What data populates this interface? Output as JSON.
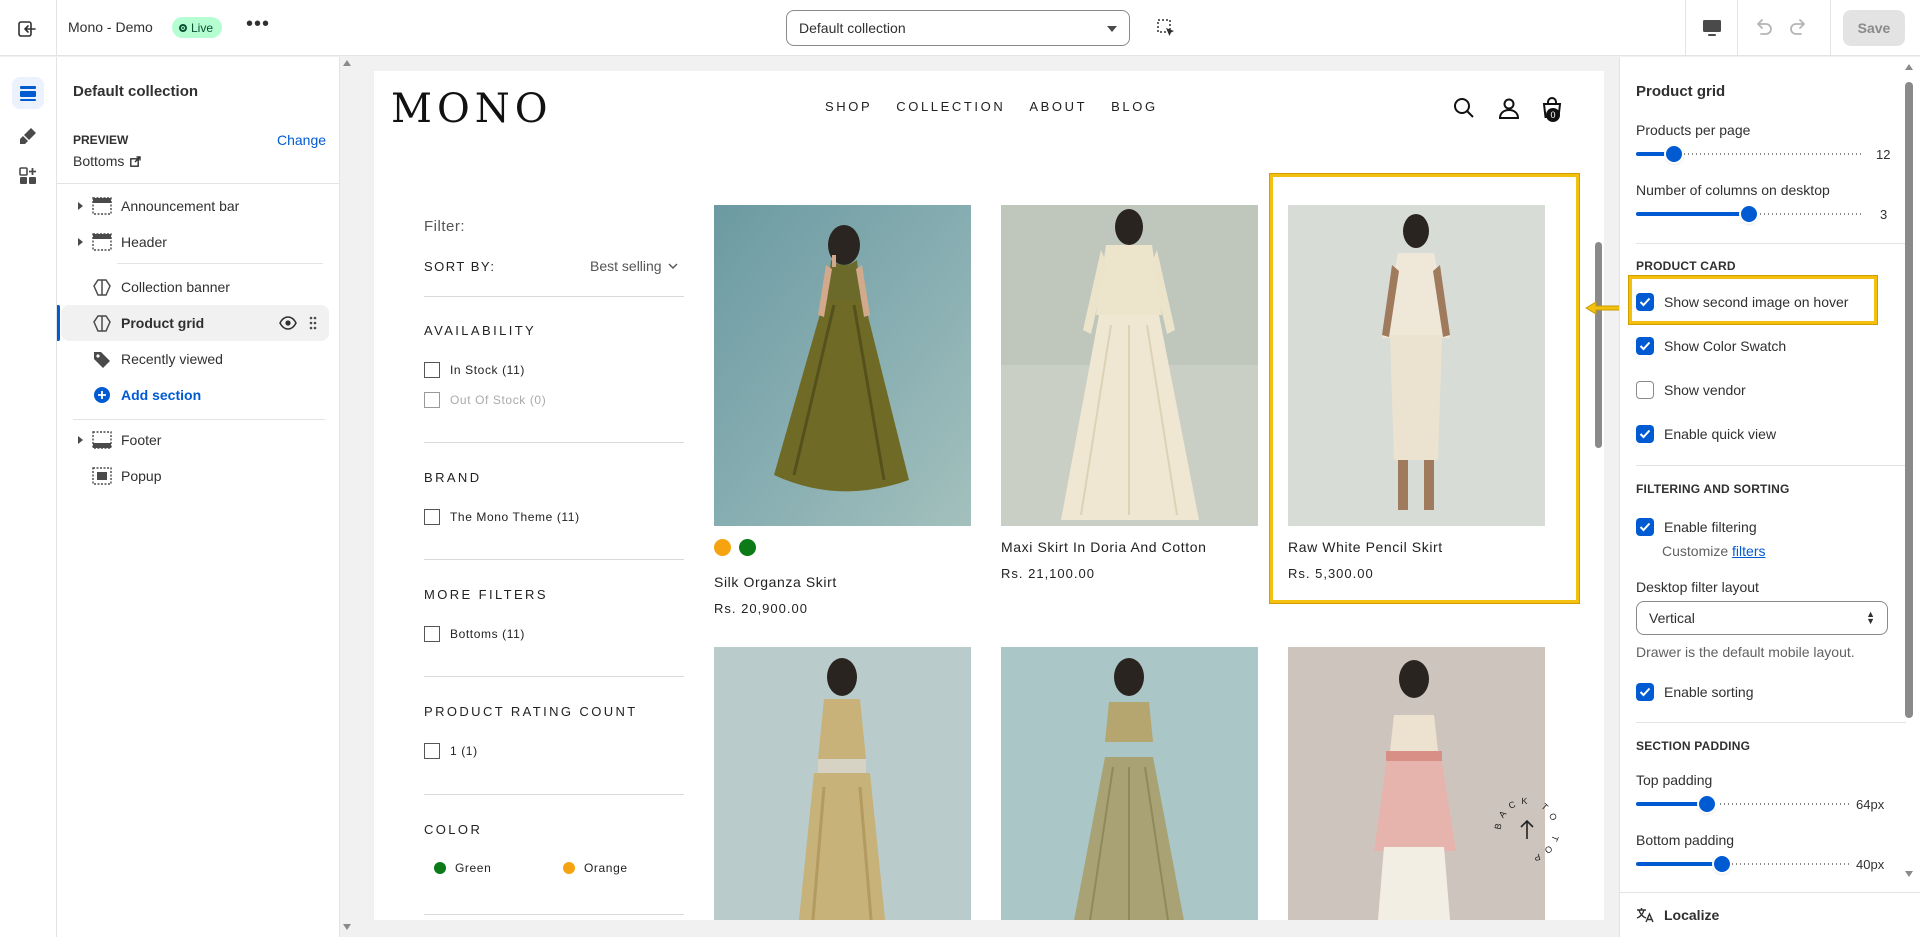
{
  "topbar": {
    "store_name": "Mono - Demo",
    "live_badge": "Live",
    "collection_select": "Default collection",
    "save_label": "Save"
  },
  "sidebar": {
    "title": "Default collection",
    "preview_label": "PREVIEW",
    "change_link": "Change",
    "preview_value": "Bottoms",
    "items": [
      {
        "label": "Announcement bar",
        "icon": "announcement-bar-icon"
      },
      {
        "label": "Header",
        "icon": "header-icon"
      },
      {
        "label": "Collection banner",
        "icon": "section-icon"
      },
      {
        "label": "Product grid",
        "icon": "section-icon"
      },
      {
        "label": "Recently viewed",
        "icon": "tag-icon"
      },
      {
        "label": "Add section",
        "icon": "plus-circle-icon"
      },
      {
        "label": "Footer",
        "icon": "footer-icon"
      },
      {
        "label": "Popup",
        "icon": "popup-icon"
      }
    ]
  },
  "store": {
    "logo": "MONO",
    "nav": [
      "SHOP",
      "COLLECTION",
      "ABOUT",
      "BLOG"
    ],
    "cart_count": "0"
  },
  "filters": {
    "title": "Filter:",
    "sort_label": "SORT BY:",
    "sort_value": "Best selling",
    "groups": [
      {
        "heading": "AVAILABILITY",
        "options": [
          "In Stock (11)",
          "Out Of Stock (0)"
        ]
      },
      {
        "heading": "BRAND",
        "options": [
          "The Mono Theme (11)"
        ]
      },
      {
        "heading": "MORE FILTERS",
        "options": [
          "Bottoms (11)"
        ]
      },
      {
        "heading": "PRODUCT RATING COUNT",
        "options": [
          "1 (1)"
        ]
      },
      {
        "heading": "COLOR",
        "options": [
          "Green",
          "Orange"
        ]
      }
    ],
    "color_swatches": {
      "green": "#0b7a17",
      "orange": "#f5a30f"
    }
  },
  "products": [
    {
      "title": "Silk Organza Skirt",
      "price": "Rs. 20,900.00",
      "swatches": [
        "#f5a30f",
        "#0b7a17"
      ]
    },
    {
      "title": "Maxi Skirt In Doria And Cotton",
      "price": "Rs. 21,100.00"
    },
    {
      "title": "Raw White Pencil Skirt",
      "price": "Rs. 5,300.00"
    }
  ],
  "backtotop_text": "BACK TO TOP",
  "panel": {
    "title": "Product grid",
    "products_per_page_label": "Products per page",
    "products_per_page_value": "12",
    "products_per_page_fraction": 0.17,
    "columns_label": "Number of columns on desktop",
    "columns_value": "3",
    "columns_fraction": 0.5,
    "product_card_heading": "PRODUCT CARD",
    "show_second_image": "Show second image on hover",
    "show_color_swatch": "Show Color Swatch",
    "show_vendor": "Show vendor",
    "enable_quick_view": "Enable quick view",
    "filtering_heading": "FILTERING AND SORTING",
    "enable_filtering": "Enable filtering",
    "customize_text": "Customize",
    "filters_link": "filters",
    "filter_layout_label": "Desktop filter layout",
    "filter_layout_value": "Vertical",
    "drawer_note": "Drawer is the default mobile layout.",
    "enable_sorting": "Enable sorting",
    "section_padding_heading": "SECTION PADDING",
    "top_padding_label": "Top padding",
    "top_padding_value": "64px",
    "top_padding_fraction": 0.33,
    "bottom_padding_label": "Bottom padding",
    "bottom_padding_value": "40px",
    "bottom_padding_fraction": 0.4,
    "localize_label": "Localize"
  },
  "colors": {
    "accent": "#005bd3",
    "highlight": "#f4c00f",
    "live_badge_bg": "#b4fed2"
  }
}
